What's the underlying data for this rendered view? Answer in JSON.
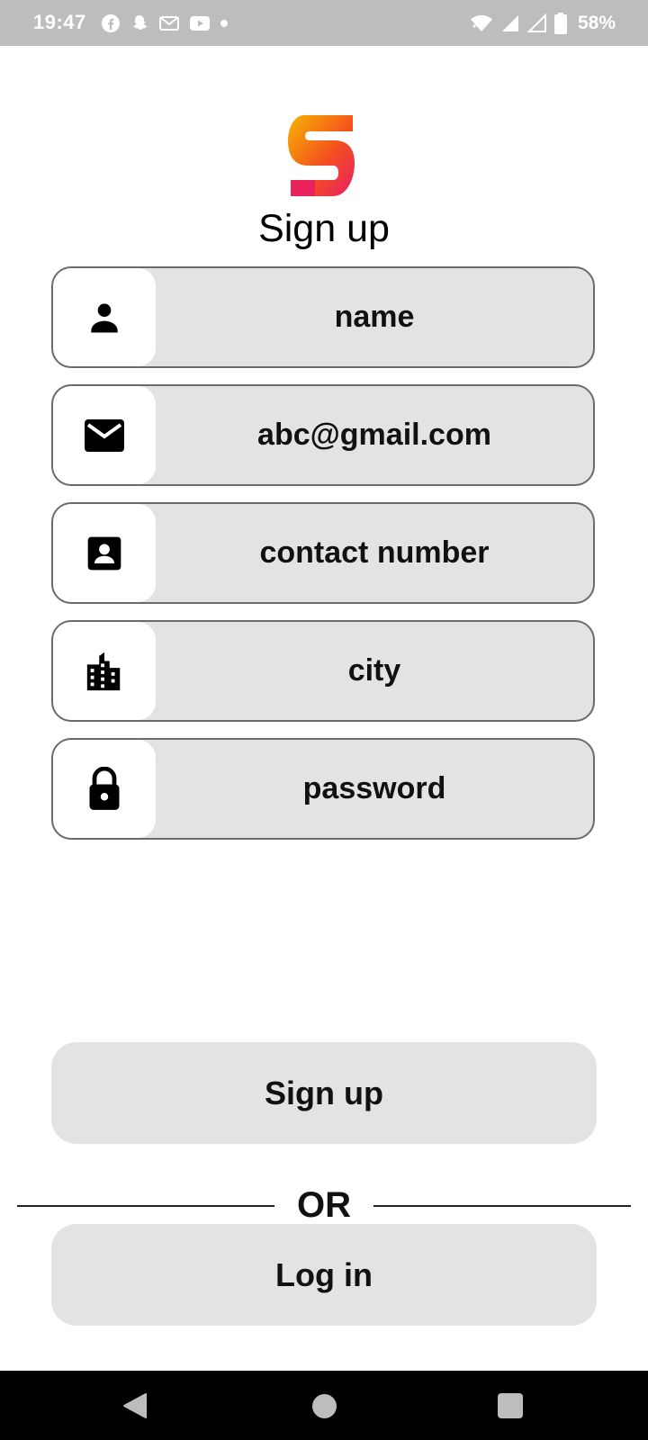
{
  "status_bar": {
    "time": "19:47",
    "battery": "58%",
    "left_icons": [
      "facebook-icon",
      "snapchat-icon",
      "gmail-icon",
      "youtube-icon",
      "dot-icon"
    ],
    "right_icons": [
      "wifi-icon",
      "signal-icon",
      "signal-icon",
      "battery-icon"
    ]
  },
  "page": {
    "title": "Sign up"
  },
  "fields": [
    {
      "icon": "person-icon",
      "text": "name"
    },
    {
      "icon": "mail-icon",
      "text": "abc@gmail.com"
    },
    {
      "icon": "contact-card-icon",
      "text": "contact number"
    },
    {
      "icon": "city-icon",
      "text": "city"
    },
    {
      "icon": "lock-icon",
      "text": "password"
    }
  ],
  "actions": {
    "signup_label": "Sign up",
    "or_label": "OR",
    "login_label": "Log in"
  },
  "colors": {
    "status_bar_bg": "#bdbdbd",
    "field_bg": "#e3e3e3",
    "logo_gradient": [
      "#f7b500",
      "#f4511e",
      "#e91e63"
    ]
  },
  "nav_bar": {
    "buttons": [
      "back-icon",
      "home-icon",
      "recents-icon"
    ]
  }
}
